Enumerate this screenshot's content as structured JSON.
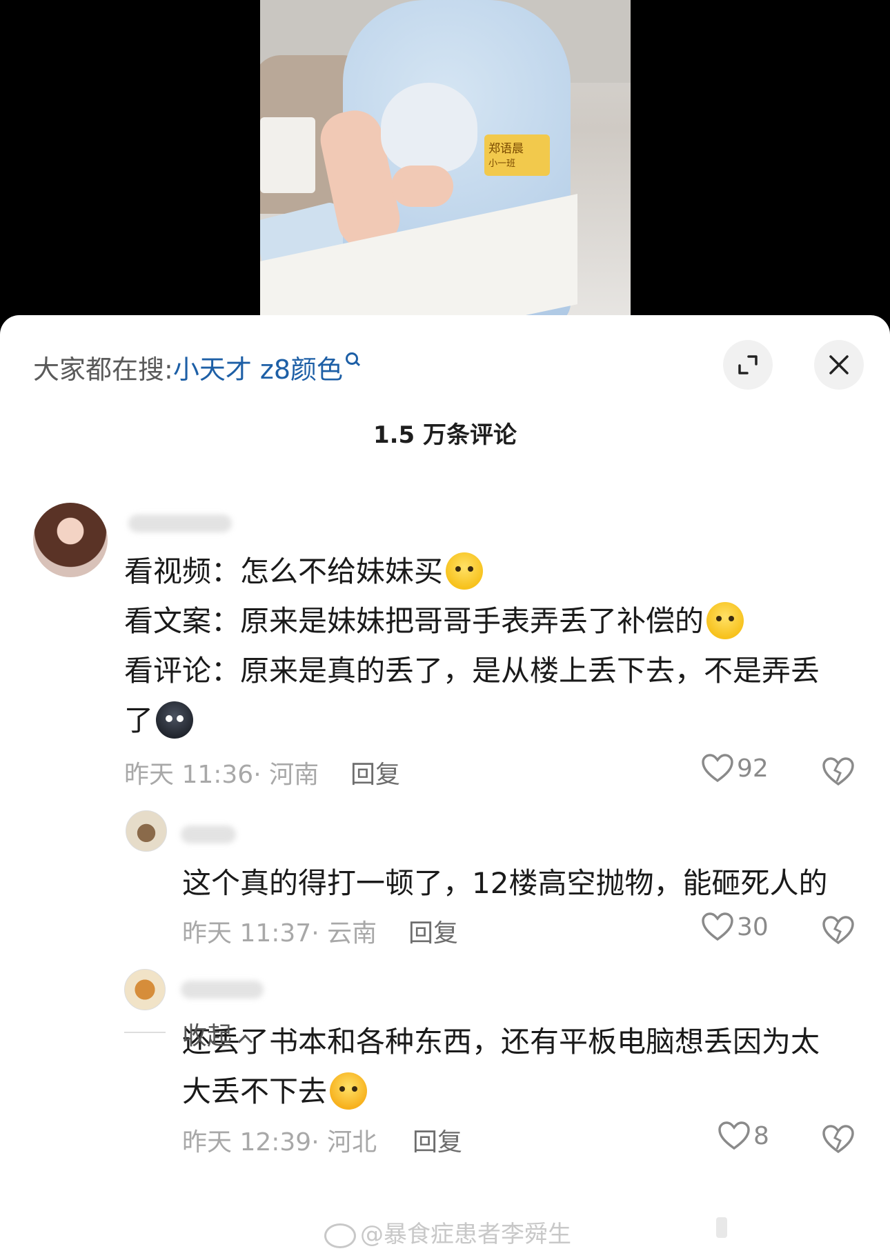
{
  "search": {
    "prefix": "大家都在搜:",
    "term": "小天才 z8颜色"
  },
  "header": {
    "comment_count": "1.5 万条评论"
  },
  "video": {
    "name_tag": "郑语晨",
    "class_tag": "小一班"
  },
  "comments": [
    {
      "lines": [
        "看视频：怎么不给妹妹买",
        "看文案：原来是妹妹把哥哥手表弄丢了补偿的",
        "看评论：原来是真的丢了，是从楼上丢下去，不是弄丢",
        "了"
      ],
      "emojis": [
        "angry",
        "shocked",
        "",
        "sweat"
      ],
      "meta": "昨天 11:36· 河南",
      "reply_label": "回复",
      "likes": "92"
    },
    {
      "lines": [
        "这个真的得打一顿了，12楼高空抛物，能砸死人的"
      ],
      "meta": "昨天 11:37· 云南",
      "reply_label": "回复",
      "likes": "30"
    },
    {
      "lines": [
        "还丢了书本和各种东西，还有平板电脑想丢因为太",
        "大丢不下去"
      ],
      "emojis": [
        "",
        "cry"
      ],
      "meta": "昨天 12:39· 河北",
      "reply_label": "回复",
      "likes": "8"
    }
  ],
  "collapse_label": "收起",
  "watermark": "@暴食症患者李舜生",
  "colors": {
    "search_term": "#1d5fa6",
    "meta_text": "#a8a8a8",
    "sheet_bg": "#ffffff"
  }
}
